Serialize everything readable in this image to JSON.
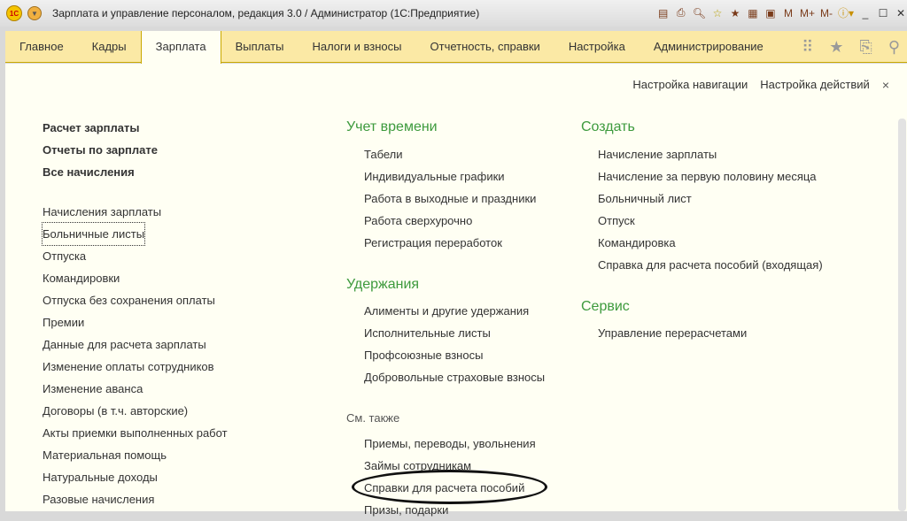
{
  "window": {
    "title": "Зарплата и управление персоналом, редакция 3.0 / Администратор  (1С:Предприятие)",
    "logo": "1С",
    "toolbar_icons": [
      "save-icon",
      "print-icon",
      "preview-icon",
      "add-favorite-icon",
      "favorites-icon",
      "calculator-icon",
      "calendar-icon"
    ],
    "memory_buttons": [
      "M",
      "M+",
      "M-"
    ]
  },
  "menu": {
    "items": [
      "Главное",
      "Кадры",
      "Зарплата",
      "Выплаты",
      "Налоги и взносы",
      "Отчетность, справки",
      "Настройка",
      "Администрирование"
    ],
    "active": "Зарплата"
  },
  "top_actions": {
    "nav_settings": "Настройка навигации",
    "action_settings": "Настройка действий",
    "close": "×"
  },
  "left": {
    "bold": [
      "Расчет зарплаты",
      "Отчеты по зарплате",
      "Все начисления"
    ],
    "items": [
      "Начисления зарплаты",
      "Больничные листы",
      "Отпуска",
      "Командировки",
      "Отпуска без сохранения оплаты",
      "Премии",
      "Данные для расчета зарплаты",
      "Изменение оплаты сотрудников",
      "Изменение аванса",
      "Договоры (в т.ч. авторские)",
      "Акты приемки выполненных работ",
      "Материальная помощь",
      "Натуральные доходы",
      "Разовые начисления"
    ]
  },
  "middle": {
    "time": {
      "heading": "Учет времени",
      "items": [
        "Табели",
        "Индивидуальные графики",
        "Работа в выходные и праздники",
        "Работа сверхурочно",
        "Регистрация переработок"
      ]
    },
    "deductions": {
      "heading": "Удержания",
      "items": [
        "Алименты и другие удержания",
        "Исполнительные листы",
        "Профсоюзные взносы",
        "Добровольные страховые взносы"
      ]
    },
    "see_also": {
      "heading": "См. также",
      "items": [
        "Приемы, переводы, увольнения",
        "Займы сотрудникам",
        "Справки для расчета пособий",
        "Призы, подарки"
      ]
    }
  },
  "right": {
    "create": {
      "heading": "Создать",
      "items": [
        "Начисление зарплаты",
        "Начисление за первую половину месяца",
        "Больничный лист",
        "Отпуск",
        "Командировка",
        "Справка для расчета пособий (входящая)"
      ]
    },
    "service": {
      "heading": "Сервис",
      "items": [
        "Управление перерасчетами"
      ]
    }
  }
}
